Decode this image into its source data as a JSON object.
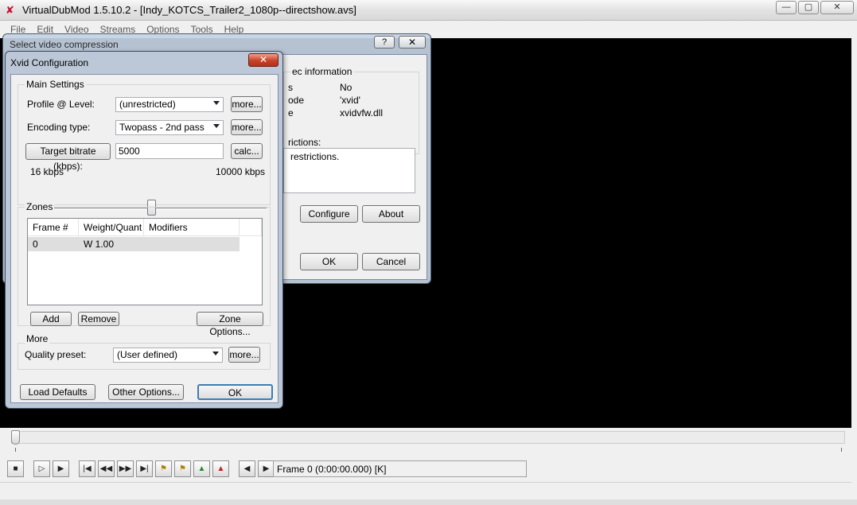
{
  "main_window": {
    "title": "VirtualDubMod 1.5.10.2 - [Indy_KOTCS_Trailer2_1080p--directshow.avs]",
    "app_icon": "virtualdub-icon",
    "controls": {
      "minimize": "—",
      "maximize": "▢",
      "close": "✕"
    },
    "menu": [
      "File",
      "Edit",
      "Video",
      "Streams",
      "Options",
      "Tools",
      "Help"
    ],
    "frame_status": "Frame 0 (0:00:00.000) [K]",
    "toolbar_icons": [
      "stop-icon",
      "play-input-icon",
      "play-output-icon",
      "start-icon",
      "prev-key-icon",
      "next-key-icon",
      "end-icon",
      "mark-in-icon",
      "mark-out-icon",
      "scene-prev-icon",
      "scene-next-icon",
      "prev-frame-icon",
      "next-frame-icon"
    ]
  },
  "compression_dialog": {
    "title": "Select video compression",
    "help_btn": "?",
    "close_btn": "✕",
    "codec_info_legend": "ec information",
    "rows": [
      {
        "label": "s",
        "value": "No"
      },
      {
        "label": "ode",
        "value": "'xvid'"
      },
      {
        "label": "e",
        "value": "xvidvfw.dll"
      }
    ],
    "restrictions_label": "rictions:",
    "restrictions_text": "restrictions.",
    "configure": "Configure",
    "about": "About",
    "ok": "OK",
    "cancel": "Cancel"
  },
  "xvid": {
    "title": "Xvid Configuration",
    "close_btn": "✕",
    "main_settings_legend": "Main Settings",
    "profile_label": "Profile @ Level:",
    "profile_value": "(unrestricted)",
    "encoding_label": "Encoding type:",
    "encoding_value": "Twopass - 2nd pass",
    "more": "more...",
    "target_bitrate_btn": "Target bitrate (kbps):",
    "bitrate_value": "5000",
    "calc": "calc...",
    "slider_min": "16 kbps",
    "slider_max": "10000 kbps",
    "slider_fraction": 0.5,
    "zones_legend": "Zones",
    "zone_columns": [
      "Frame #",
      "Weight/Quant",
      "Modifiers"
    ],
    "zone_rows": [
      {
        "frame": "0",
        "weight": "W 1.00",
        "modifiers": ""
      }
    ],
    "add": "Add",
    "remove": "Remove",
    "zone_options": "Zone Options...",
    "more_legend": "More",
    "quality_label": "Quality preset:",
    "quality_value": "(User defined)",
    "load_defaults": "Load Defaults",
    "other_options": "Other Options...",
    "ok": "OK"
  }
}
